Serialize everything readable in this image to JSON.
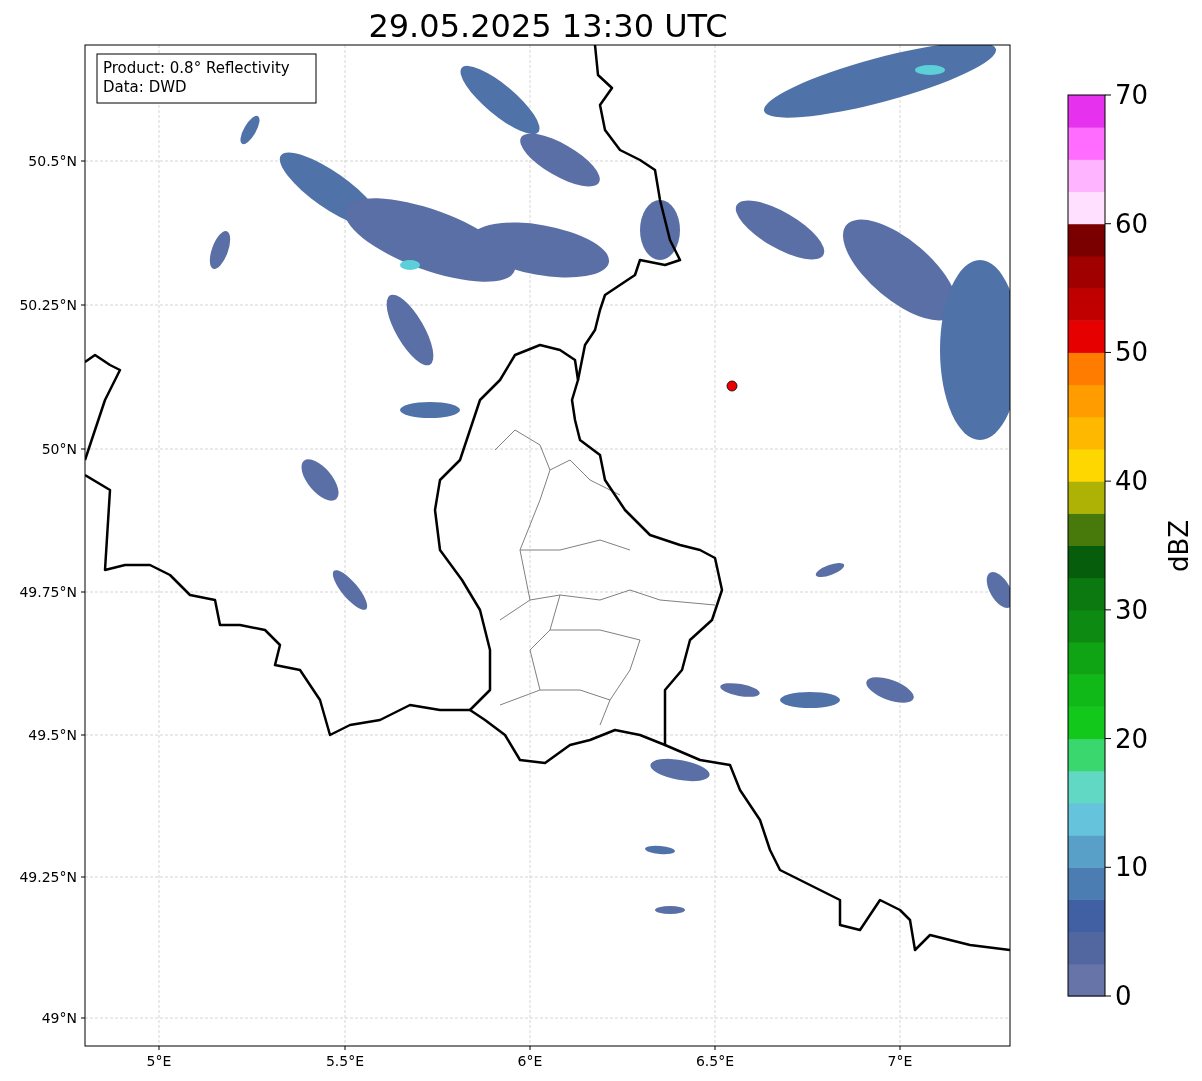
{
  "title": "29.05.2025 13:30 UTC",
  "info_box": [
    "Product: 0.8° Reflectivity",
    "Data: DWD"
  ],
  "x_ticks": [
    "5°E",
    "5.5°E",
    "6°E",
    "6.5°E",
    "7°E"
  ],
  "y_ticks": [
    "50.5°N",
    "50.25°N",
    "50°N",
    "49.75°N",
    "49.5°N",
    "49.25°N",
    "49°N"
  ],
  "colorbar": {
    "label": "dBZ",
    "ticks": [
      "70",
      "60",
      "50",
      "40",
      "30",
      "20",
      "10",
      "0"
    ],
    "segments": [
      {
        "color": "#6674a8"
      },
      {
        "color": "#52679f"
      },
      {
        "color": "#4160a4"
      },
      {
        "color": "#4c7db2"
      },
      {
        "color": "#58a0c8"
      },
      {
        "color": "#66c3dc"
      },
      {
        "color": "#60d8c4"
      },
      {
        "color": "#3ad66e"
      },
      {
        "color": "#12c81a"
      },
      {
        "color": "#10b818"
      },
      {
        "color": "#0ea414"
      },
      {
        "color": "#0c8a12"
      },
      {
        "color": "#0b7810"
      },
      {
        "color": "#065d0c"
      },
      {
        "color": "#477a0b"
      },
      {
        "color": "#adb204"
      },
      {
        "color": "#ffd700"
      },
      {
        "color": "#ffb800"
      },
      {
        "color": "#ff9c00"
      },
      {
        "color": "#ff7c00"
      },
      {
        "color": "#e60000"
      },
      {
        "color": "#c00000"
      },
      {
        "color": "#a00000"
      },
      {
        "color": "#7a0000"
      },
      {
        "color": "#ffe0ff"
      },
      {
        "color": "#ffb4ff"
      },
      {
        "color": "#ff6cff"
      },
      {
        "color": "#e632ee"
      }
    ]
  }
}
